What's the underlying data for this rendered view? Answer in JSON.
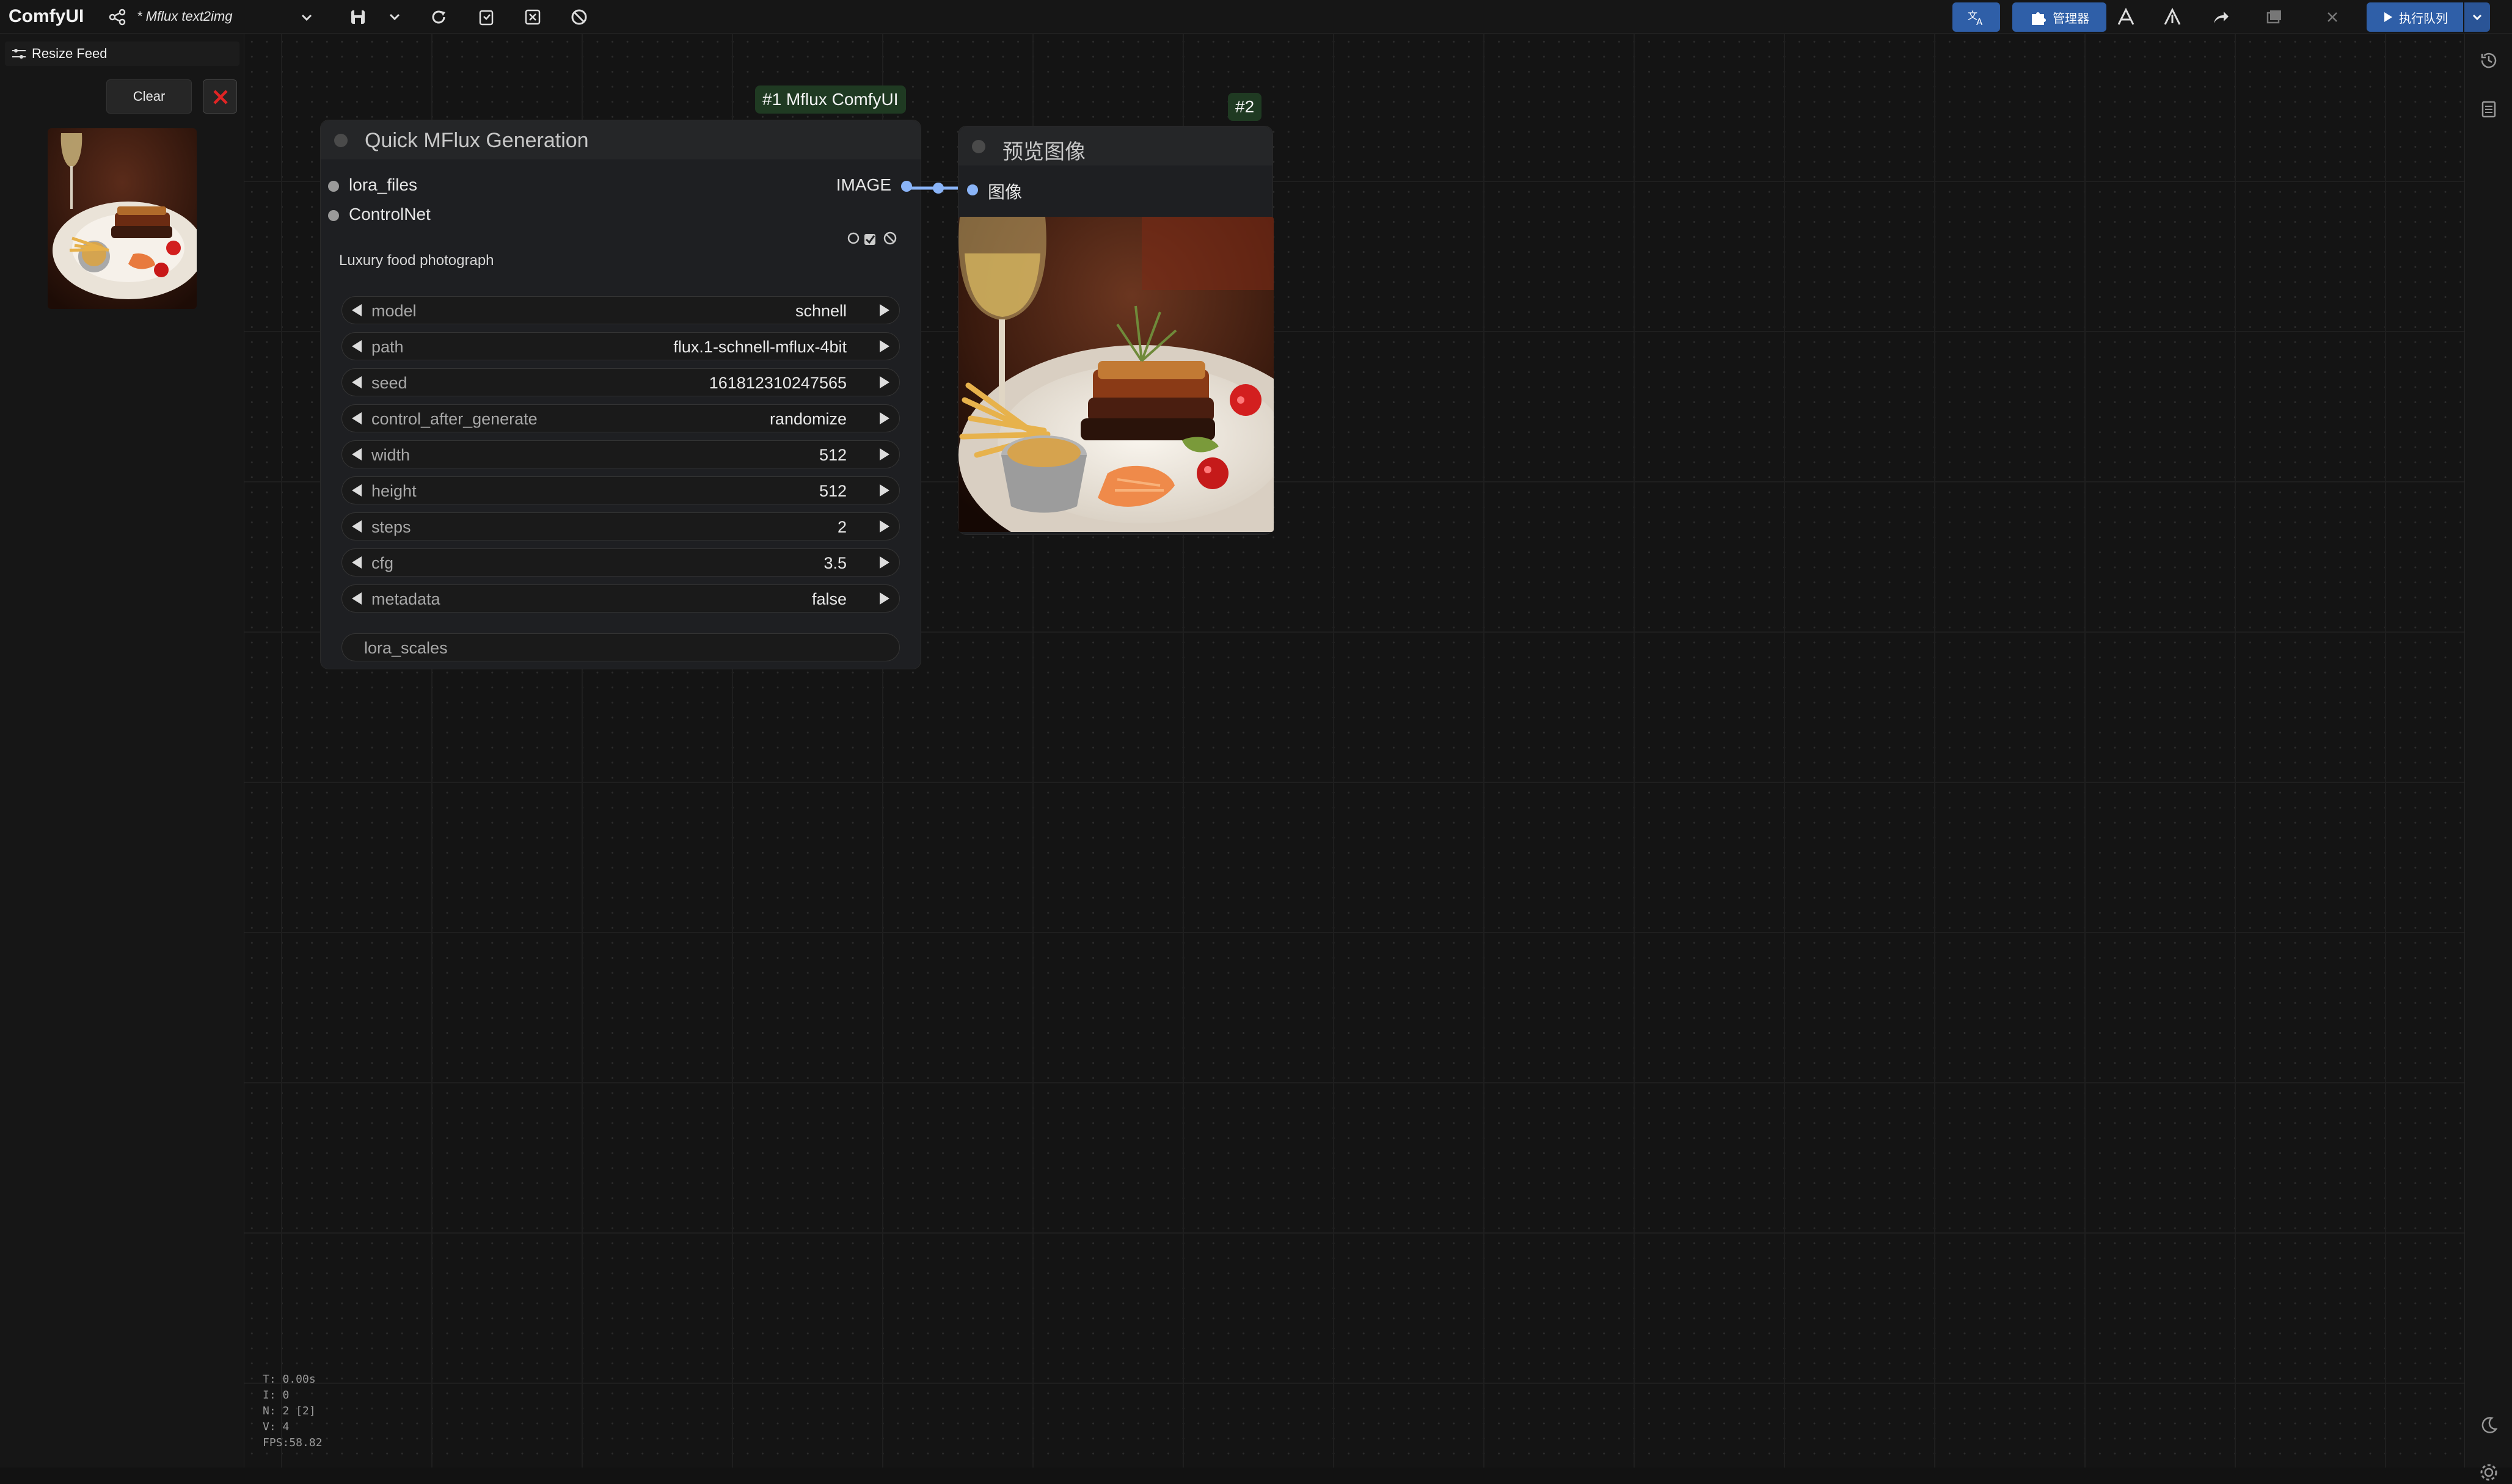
{
  "app": {
    "brand": "ComfyUI",
    "workflow_title": "* Mflux text2img"
  },
  "toolbar": {
    "translate_label": "",
    "manager_label": "管理器",
    "queue_label": "执行队列"
  },
  "feed": {
    "title": "Resize Feed",
    "clear_label": "Clear"
  },
  "node1": {
    "badge": "#1 Mflux ComfyUI",
    "title": "Quick MFlux Generation",
    "inputs": [
      "lora_files",
      "ControlNet"
    ],
    "output": "IMAGE",
    "prompt": "Luxury food photograph",
    "widgets": [
      {
        "label": "model",
        "value": "schnell"
      },
      {
        "label": "path",
        "value": "flux.1-schnell-mflux-4bit"
      },
      {
        "label": "seed",
        "value": "161812310247565"
      },
      {
        "label": "control_after_generate",
        "value": "randomize"
      },
      {
        "label": "width",
        "value": "512"
      },
      {
        "label": "height",
        "value": "512"
      },
      {
        "label": "steps",
        "value": "2"
      },
      {
        "label": "cfg",
        "value": "3.5"
      },
      {
        "label": "metadata",
        "value": "false"
      }
    ],
    "text_widget": "lora_scales"
  },
  "node2": {
    "badge": "#2",
    "title": "预览图像",
    "input": "图像"
  },
  "stats": [
    "T: 0.00s",
    "I: 0",
    "N: 2 [2]",
    "V: 4",
    "FPS:58.82"
  ],
  "colors": {
    "accent": "#2f5fa8",
    "badge_bg": "#1f3a22",
    "close_red": "#e02424",
    "link": "#8ab4f8"
  }
}
